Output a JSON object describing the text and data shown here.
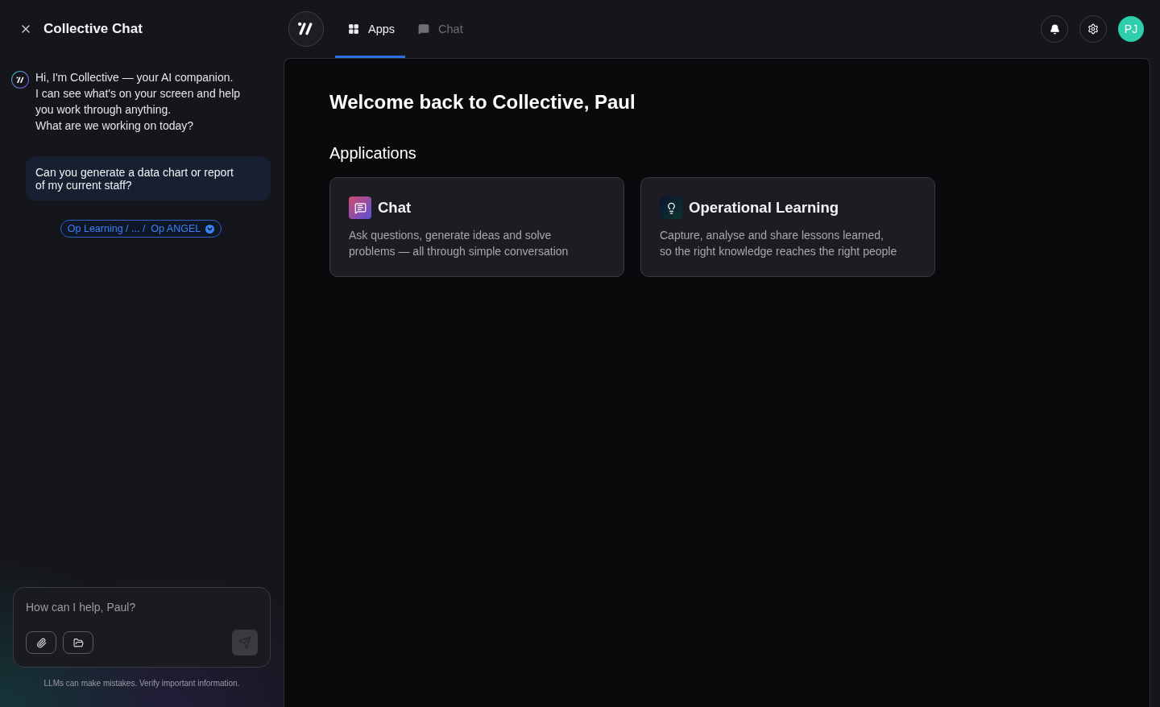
{
  "sidebar": {
    "title": "Collective Chat",
    "messages": [
      {
        "kind": "assistant",
        "lines": [
          "Hi, I'm Collective — your AI companion.",
          "I can see what's on your screen and help",
          "you work through anything.",
          "What are we working on today?"
        ]
      },
      {
        "kind": "user",
        "lines": [
          "Can you generate a data chart or report",
          "of my current staff?"
        ]
      }
    ],
    "context_chip": "Op Learning / ... /  Op ANGEL",
    "composer": {
      "placeholder": "How can I help, Paul?",
      "send_disabled": true
    },
    "disclaimer": "LLMs can make mistakes. Verify important information."
  },
  "tabs": [
    {
      "label": "Apps",
      "kind": "apps",
      "selected": true
    },
    {
      "label": "Chat",
      "kind": "chat",
      "selected": false
    }
  ],
  "user": {
    "initials": "PJ"
  },
  "main": {
    "heading": "Welcome back to Collective, Paul",
    "section": "Applications",
    "apps": [
      {
        "kind": "chat",
        "title": "Chat",
        "lines": [
          "Ask questions, generate ideas and solve",
          "problems — all through simple conversation"
        ]
      },
      {
        "kind": "learning",
        "title": "Operational Learning",
        "lines": [
          "Capture, analyse and share lessons learned,",
          "so the right knowledge reaches the right people"
        ]
      }
    ]
  }
}
